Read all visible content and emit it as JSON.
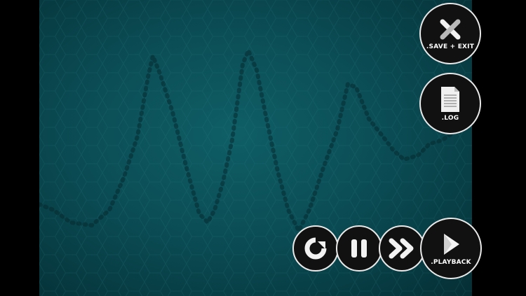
{
  "controls": {
    "save_exit_label": ".SAVE + EXIT",
    "log_label": ".LOG",
    "playback_label": ".PLAYBACK"
  },
  "icons": {
    "save_exit": "close-x-icon",
    "log": "document-icon",
    "restart": "restart-icon",
    "pause": "pause-icon",
    "fast_forward": "fast-forward-icon",
    "playback": "play-icon"
  },
  "colors": {
    "field": "#0b4d55",
    "button_fill": "#111111",
    "button_border": "#e9e9e9",
    "trace": "#052a30"
  }
}
